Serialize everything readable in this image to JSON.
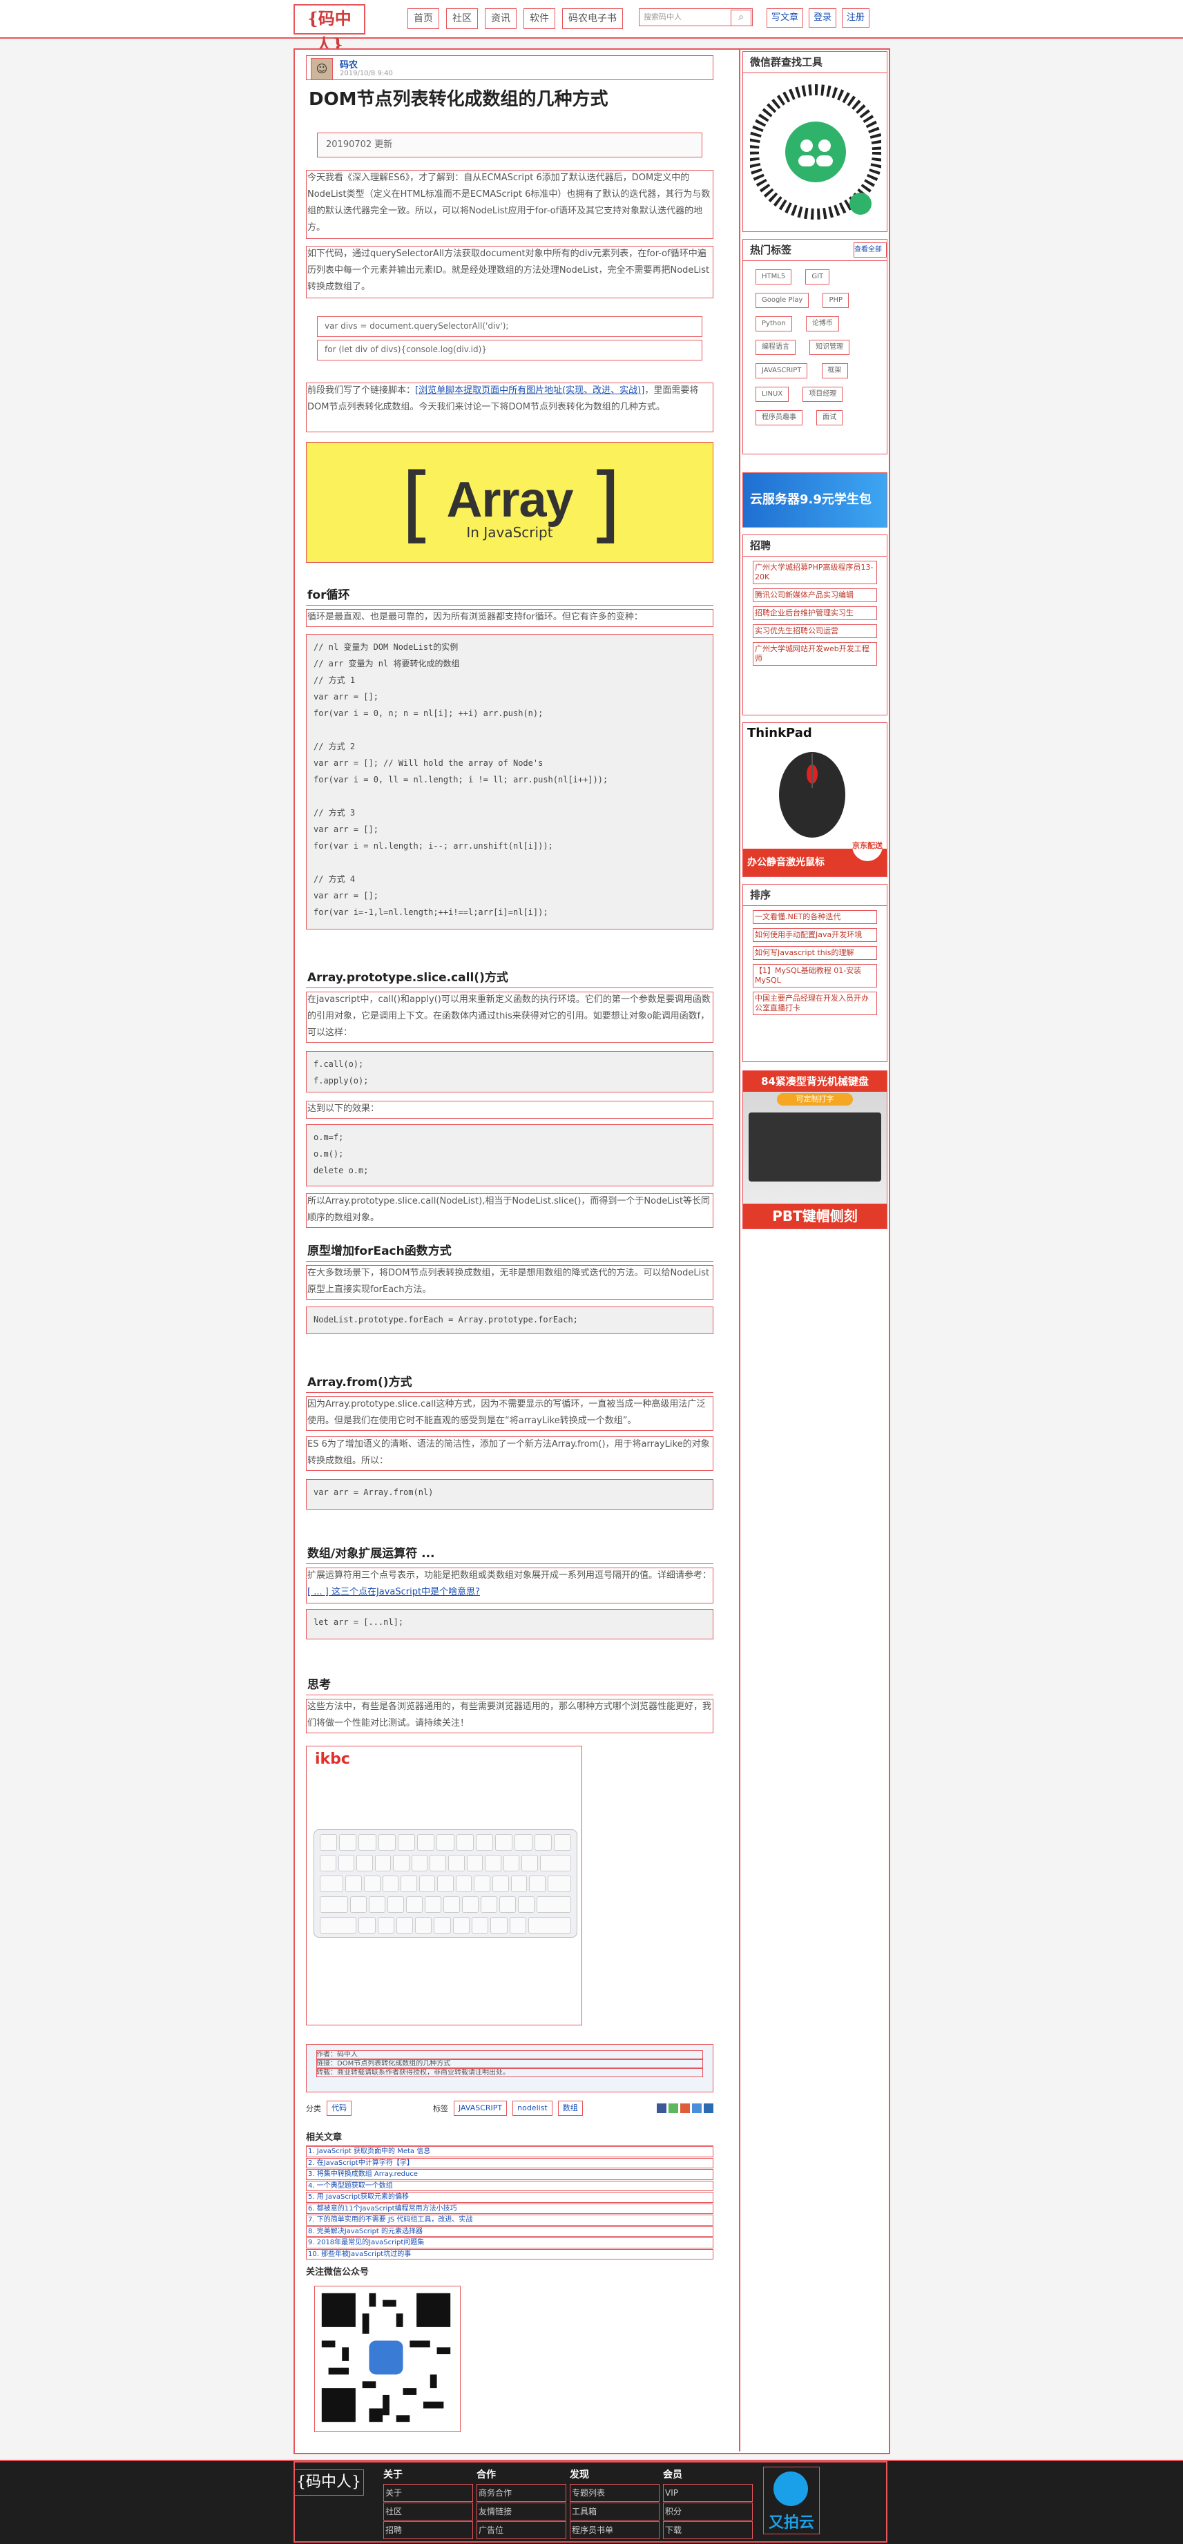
{
  "header": {
    "logo": "{码中人}",
    "nav": [
      "首页",
      "社区",
      "资讯",
      "软件",
      "码农电子书"
    ],
    "search_placeholder": "搜索码中人",
    "user_links": [
      "写文章",
      "登录",
      "注册"
    ]
  },
  "article": {
    "author": "码农",
    "date": "2019/10/8 9:40",
    "title": "DOM节点列表转化成数组的几种方式",
    "update": "20190702 更新",
    "intro1": "今天我看《深入理解ES6》，才了解到：自从ECMAScript 6添加了默认迭代器后，DOM定义中的NodeList类型（定义在HTML标准而不是ECMAScript 6标准中）也拥有了默认的迭代器，其行为与数组的默认迭代器完全一致。所以，可以将NodeList应用于for-of语环及其它支持对象默认迭代器的地方。",
    "intro2": "如下代码，通过querySelectorAll方法获取document对象中所有的div元素列表，在for-of循环中遍历列表中每一个元素并输出元素ID。就是经处理数组的方法处理NodeList，完全不需要再把NodeList 转换成数组了。",
    "code1": [
      "var divs = document.querySelectorAll('div');",
      "for (let div of divs){console.log(div.id)}"
    ],
    "intro3_pre": "前段我们写了个链接脚本：",
    "intro3_link": "[浏览单脚本提取页面中所有图片地址(实现、改进、实战)]",
    "intro3_post": "，里面需要将DOM节点列表转化成数组。今天我们来讨论一下将DOM节点列表转化为数组的几种方式。",
    "image_big": "Array",
    "image_sub": "In JavaScript",
    "h_for": "for循环",
    "for_text": "循环是最直观、也是最可靠的，因为所有浏览器都支持for循环。但它有许多的变种：",
    "for_code": "// nl 变量为 DOM NodeList的实例\n// arr 变量为 nl 将要转化成的数组\n// 方式 1\nvar arr = [];\nfor(var i = 0, n; n = nl[i]; ++i) arr.push(n);\n\n// 方式 2\nvar arr = []; // Will hold the array of Node's\nfor(var i = 0, ll = nl.length; i != ll; arr.push(nl[i++]));\n\n// 方式 3\nvar arr = [];\nfor(var i = nl.length; i--; arr.unshift(nl[i]));\n\n// 方式 4\nvar arr = [];\nfor(var i=-1,l=nl.length;++i!==l;arr[i]=nl[i]);",
    "h_slice": "Array.prototype.slice.call()方式",
    "slice_text": "在javascript中，call()和apply()可以用来重新定义函数的执行环境。它们的第一个参数是要调用函数的引用对象，它是调用上下文。在函数体内通过this来获得对它的引用。如要想让对象o能调用函数f，可以这样：",
    "slice_code1": "f.call(o);\nf.apply(o);",
    "slice_text2": "达到以下的效果：",
    "slice_code2": "o.m=f;\no.m();\ndelete o.m;",
    "slice_text3": "所以Array.prototype.slice.call(NodeList),相当于NodeList.slice()，而得到一个于NodeList等长同顺序的数组对象。",
    "h_foreach": "原型增加forEach函数方式",
    "foreach_text": "在大多数场景下，将DOM节点列表转换成数组，无非是想用数组的降式迭代的方法。可以给NodeList原型上直接实现forEach方法。",
    "foreach_code": "NodeList.prototype.forEach = Array.prototype.forEach;",
    "h_from": "Array.from()方式",
    "from_text1": "因为Array.prototype.slice.call这种方式，因为不需要显示的写循环，一直被当成一种高级用法广泛使用。但是我们在使用它时不能直观的感受到是在“将arrayLike转换成一个数组”。",
    "from_text2": "ES 6为了增加语义的清晰、语法的简洁性，添加了一个新方法Array.from()，用于将arrayLike的对象转换成数组。所以：",
    "from_code": "var arr = Array.from(nl)",
    "h_spread": "数组/对象扩展运算符 ...",
    "spread_text_pre": "扩展运算符用三个点号表示，功能是把数组或类数组对象展开成一系列用逗号隔开的值。详细请参考：",
    "spread_link": "[ ... ] 这三个点在JavaScript中是个啥意思?",
    "spread_code": "let arr = [...nl];",
    "h_think": "思考",
    "think_text": "这些方法中，有些是各浏览器通用的，有些需要浏览器适用的，那么哪种方式哪个浏览器性能更好，我们将做一个性能对比测试。请持续关注！"
  },
  "ad_keyboard": {
    "brand": "ikbc"
  },
  "info_box": {
    "lines": [
      "作者：码中人",
      "链接：DOM节点列表转化成数组的几种方式",
      "转载：商业转载请联系作者获得授权，非商业转载请注明出处。"
    ]
  },
  "tags_row": {
    "category_label": "分类",
    "category": "代码",
    "tag_label": "标签",
    "tags": [
      "JAVASCRIPT",
      "nodelist",
      "数组"
    ]
  },
  "related": {
    "title": "相关文章",
    "items": [
      "1. JavaScript 获取页面中的 Meta 信息",
      "2. 在JavaScript中计算字符【字】",
      "3. 将集中转换成数组 Array.reduce",
      "4. 一个典型题获取一个数组",
      "5. 用 JavaScript获取元素的偏移",
      "6. 都被意的11个JavaScript编程常用方法小技巧",
      "7. 下的简单实用的不需要 JS 代码组工具，改进、实战",
      "8. 完美解决JavaScript 的元素选择器",
      "9. 2018年最常见的JavaScript问题集",
      "10. 那些年被JavaScript坑过的事"
    ]
  },
  "qr_section": {
    "title": "关注微信公众号"
  },
  "sidebar": {
    "wechat_title": "微信群查找工具",
    "hot_tags_title": "热门标签",
    "hot_tags_more": "查看全部",
    "hot_tags": [
      "HTML5",
      "GIT",
      "Google Play",
      "PHP",
      "Python",
      "论博币",
      "编程语言",
      "知识管理",
      "JAVASCRIPT",
      "框架",
      "LINUX",
      "项目经理",
      "程序员趣事",
      "面试"
    ],
    "ad1_text": "云服务器9.9元学生包",
    "recruit_title": "招聘",
    "recruit_items": [
      "广州大学城招募PHP高级程序员13-20K",
      "腾讯公司新媒体产品实习编辑",
      "招聘企业后台维护管理实习生",
      "实习优先生招聘公司运营",
      "广州大学城网站开发web开发工程师"
    ],
    "ad_mouse_brand": "ThinkPad",
    "ad_mouse_caption": "办公静音激光鼠标",
    "ad_mouse_badge": "京东配送",
    "sort_title": "排序",
    "sort_items": [
      "一文看懂.NET的各种迭代",
      "如何使用手动配置Java开发环境",
      "如何写Javascript this的理解",
      "【1】MySQL基础教程 01-安装MySQL",
      "中国主要产品经理在开发入员开办公室直播打卡"
    ],
    "ad_kb_title": "84紧凑型背光机械键盘",
    "ad_kb_sub": "可定制打字",
    "ad_kb_bottom": "PBT键帽侧刻"
  },
  "footer": {
    "logo": "{码中人}",
    "cols": [
      {
        "title": "关于",
        "items": [
          "关于",
          "社区",
          "招聘"
        ]
      },
      {
        "title": "合作",
        "items": [
          "商务合作",
          "友情链接",
          "广告位"
        ]
      },
      {
        "title": "发现",
        "items": [
          "专题列表",
          "工具箱",
          "程序员书单"
        ]
      },
      {
        "title": "会员",
        "items": [
          "VIP",
          "积分",
          "下载"
        ]
      }
    ],
    "cloud": "又拍云"
  }
}
